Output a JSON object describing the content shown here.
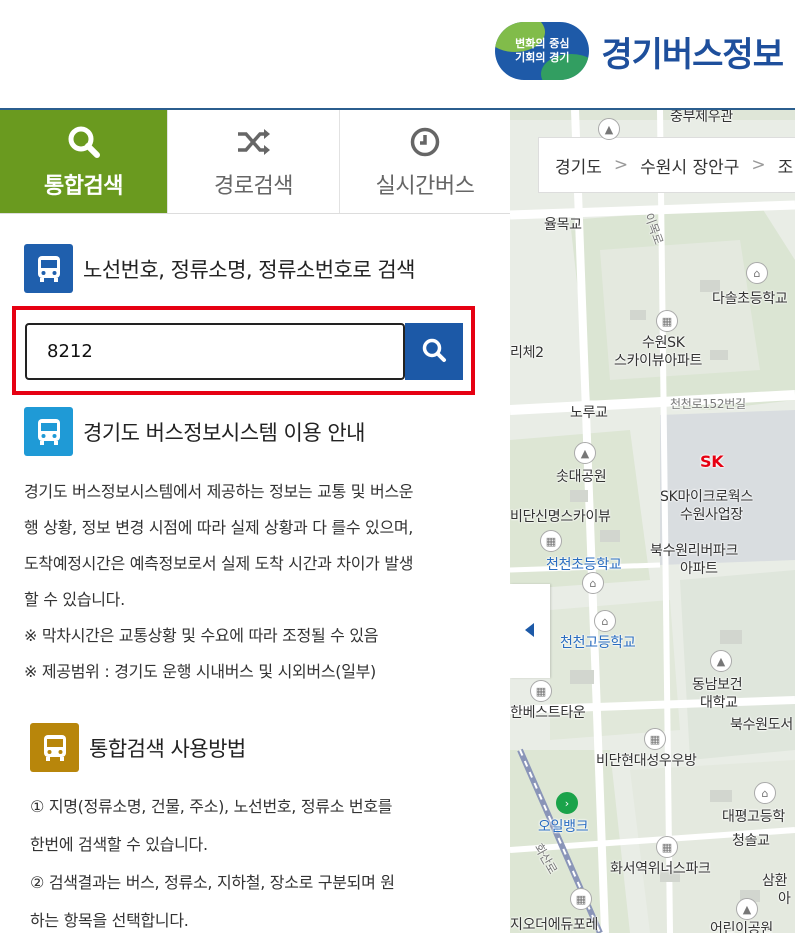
{
  "header": {
    "logo_badge_line1": "변화의 중심",
    "logo_badge_line2": "기회의 경기",
    "logo_title": "경기버스정보"
  },
  "tabs": [
    {
      "label": "통합검색",
      "icon": "search-icon",
      "active": true
    },
    {
      "label": "경로검색",
      "icon": "shuffle-icon",
      "active": false
    },
    {
      "label": "실시간버스",
      "icon": "clock-icon",
      "active": false
    }
  ],
  "search_section": {
    "title": "노선번호, 정류소명, 정류소번호로 검색",
    "input_value": "8212",
    "button_icon": "search-icon"
  },
  "info_section": {
    "title": "경기도 버스정보시스템 이용 안내",
    "lines": [
      "경기도 버스정보시스템에서 제공하는 정보는 교통 및 버스운",
      "행 상황, 정보 변경 시점에 따라 실제 상황과 다 를수 있으며,",
      "도착예정시간은 예측정보로서 실제 도착 시간과 차이가 발생",
      "할 수 있습니다.",
      "※ 막차시간은 교통상황 및 수요에 따라 조정될 수 있음",
      "※ 제공범위 : 경기도 운행 시내버스 및 시외버스(일부)"
    ]
  },
  "usage_section": {
    "title": "통합검색 사용방법",
    "lines": [
      "① 지명(정류소명, 건물, 주소), 노선번호, 정류소 번호를",
      "한번에 검색할 수 있습니다.",
      "② 검색결과는 버스, 정류소, 지하철, 장소로 구분되며 원",
      "하는 항목을 선택합니다."
    ]
  },
  "map": {
    "breadcrumb": [
      "경기도",
      "수원시 장안구",
      "조"
    ],
    "labels": {
      "l1": "중부제우관",
      "l2": "율목교",
      "l3": "다솔초등학교",
      "l4": "수원SK",
      "l5": "스카이뷰아파트",
      "l6": "리체2",
      "l7": "노루교",
      "l8": "천천로152번길",
      "l9": "솟대공원",
      "l10": "SK",
      "l11": "SK마이크로웍스",
      "l12": "수원사업장",
      "l13": "비단신명스카이뷰",
      "l14": "북수원리버파크",
      "l15": "아파트",
      "l16": "천천초등학교",
      "l17": "천천고등학교",
      "l18": "동남보건",
      "l19": "대학교",
      "l20": "북수원도서",
      "l21": "한베스트타운",
      "l22": "비단현대성우우방",
      "l23": "대평고등학",
      "l24": "오일뱅크",
      "l25": "청솔교",
      "l26": "화서역위너스파크",
      "l27": "삼환",
      "l28": "아",
      "l29": "지오더에듀포레",
      "l30": "어린이공원",
      "l31": "화산로",
      "l32": "이목로"
    }
  }
}
